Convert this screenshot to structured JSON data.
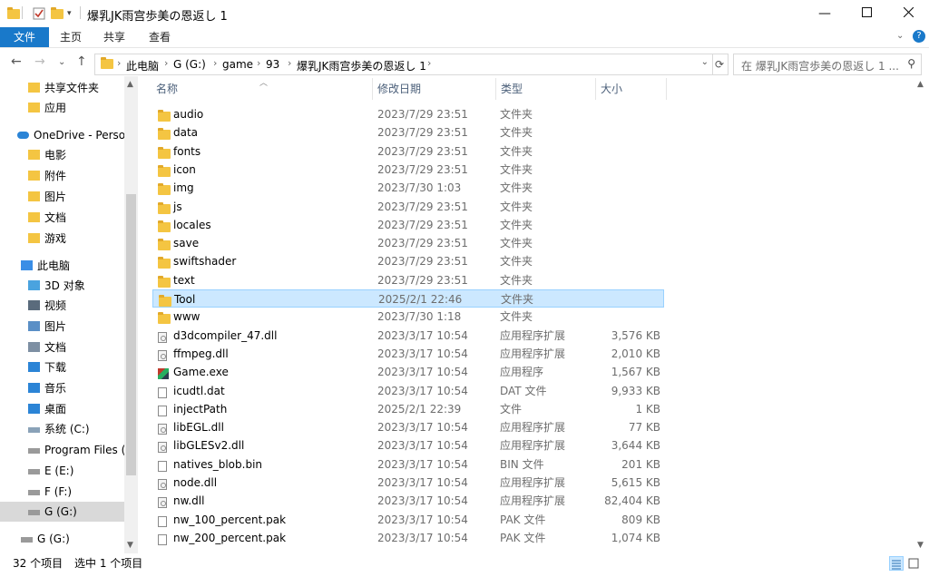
{
  "window": {
    "title": "爆乳JK雨宫歩美の恩返し 1",
    "min_icon": "minimize-icon",
    "max_icon": "maximize-icon",
    "close_icon": "close-icon"
  },
  "ribbon": {
    "tabs": [
      "文件",
      "主页",
      "共享",
      "查看"
    ]
  },
  "address": {
    "crumbs": [
      "此电脑",
      "G (G:)",
      "game",
      "93",
      "爆乳JK雨宫歩美の恩返し 1"
    ],
    "search_placeholder": "在 爆乳JK雨宫歩美の恩返し 1 ..."
  },
  "nav": {
    "items": [
      {
        "label": "共享文件夹",
        "icon": "shared-folder-icon"
      },
      {
        "label": "应用",
        "icon": "folder-icon"
      },
      {
        "label": "OneDrive - Personal",
        "icon": "cloud-icon"
      },
      {
        "label": "电影",
        "icon": "folder-icon"
      },
      {
        "label": "附件",
        "icon": "folder-icon"
      },
      {
        "label": "图片",
        "icon": "folder-icon"
      },
      {
        "label": "文档",
        "icon": "folder-icon"
      },
      {
        "label": "游戏",
        "icon": "folder-icon"
      },
      {
        "label": "此电脑",
        "icon": "pc-icon"
      },
      {
        "label": "3D 对象",
        "icon": "3d-objects-icon"
      },
      {
        "label": "视频",
        "icon": "video-icon"
      },
      {
        "label": "图片",
        "icon": "pictures-icon"
      },
      {
        "label": "文档",
        "icon": "documents-icon"
      },
      {
        "label": "下载",
        "icon": "download-icon"
      },
      {
        "label": "音乐",
        "icon": "music-icon"
      },
      {
        "label": "桌面",
        "icon": "desktop-icon"
      },
      {
        "label": "系统 (C:)",
        "icon": "system-drive-icon"
      },
      {
        "label": "Program Files (D:)",
        "icon": "drive-icon"
      },
      {
        "label": "E (E:)",
        "icon": "drive-icon"
      },
      {
        "label": "F (F:)",
        "icon": "drive-icon"
      },
      {
        "label": "G (G:)",
        "icon": "drive-icon"
      },
      {
        "label": "G (G:)",
        "icon": "drive-icon"
      }
    ]
  },
  "columns": {
    "name": "名称",
    "date": "修改日期",
    "type": "类型",
    "size": "大小"
  },
  "files": [
    {
      "name": "audio",
      "date": "2023/7/29 23:51",
      "type": "文件夹",
      "size": "",
      "icon": "folder-icon"
    },
    {
      "name": "data",
      "date": "2023/7/29 23:51",
      "type": "文件夹",
      "size": "",
      "icon": "folder-icon"
    },
    {
      "name": "fonts",
      "date": "2023/7/29 23:51",
      "type": "文件夹",
      "size": "",
      "icon": "folder-icon"
    },
    {
      "name": "icon",
      "date": "2023/7/29 23:51",
      "type": "文件夹",
      "size": "",
      "icon": "folder-icon"
    },
    {
      "name": "img",
      "date": "2023/7/30 1:03",
      "type": "文件夹",
      "size": "",
      "icon": "folder-icon"
    },
    {
      "name": "js",
      "date": "2023/7/29 23:51",
      "type": "文件夹",
      "size": "",
      "icon": "folder-icon"
    },
    {
      "name": "locales",
      "date": "2023/7/29 23:51",
      "type": "文件夹",
      "size": "",
      "icon": "folder-icon"
    },
    {
      "name": "save",
      "date": "2023/7/29 23:51",
      "type": "文件夹",
      "size": "",
      "icon": "folder-icon"
    },
    {
      "name": "swiftshader",
      "date": "2023/7/29 23:51",
      "type": "文件夹",
      "size": "",
      "icon": "folder-icon"
    },
    {
      "name": "text",
      "date": "2023/7/29 23:51",
      "type": "文件夹",
      "size": "",
      "icon": "folder-icon"
    },
    {
      "name": "Tool",
      "date": "2025/2/1 22:46",
      "type": "文件夹",
      "size": "",
      "icon": "folder-icon",
      "selected": true
    },
    {
      "name": "www",
      "date": "2023/7/30 1:18",
      "type": "文件夹",
      "size": "",
      "icon": "folder-icon"
    },
    {
      "name": "d3dcompiler_47.dll",
      "date": "2023/3/17 10:54",
      "type": "应用程序扩展",
      "size": "3,576 KB",
      "icon": "dll-icon"
    },
    {
      "name": "ffmpeg.dll",
      "date": "2023/3/17 10:54",
      "type": "应用程序扩展",
      "size": "2,010 KB",
      "icon": "dll-icon"
    },
    {
      "name": "Game.exe",
      "date": "2023/3/17 10:54",
      "type": "应用程序",
      "size": "1,567 KB",
      "icon": "exe-icon"
    },
    {
      "name": "icudtl.dat",
      "date": "2023/3/17 10:54",
      "type": "DAT 文件",
      "size": "9,933 KB",
      "icon": "file-icon"
    },
    {
      "name": "injectPath",
      "date": "2025/2/1 22:39",
      "type": "文件",
      "size": "1 KB",
      "icon": "file-icon"
    },
    {
      "name": "libEGL.dll",
      "date": "2023/3/17 10:54",
      "type": "应用程序扩展",
      "size": "77 KB",
      "icon": "dll-icon"
    },
    {
      "name": "libGLESv2.dll",
      "date": "2023/3/17 10:54",
      "type": "应用程序扩展",
      "size": "3,644 KB",
      "icon": "dll-icon"
    },
    {
      "name": "natives_blob.bin",
      "date": "2023/3/17 10:54",
      "type": "BIN 文件",
      "size": "201 KB",
      "icon": "file-icon"
    },
    {
      "name": "node.dll",
      "date": "2023/3/17 10:54",
      "type": "应用程序扩展",
      "size": "5,615 KB",
      "icon": "dll-icon"
    },
    {
      "name": "nw.dll",
      "date": "2023/3/17 10:54",
      "type": "应用程序扩展",
      "size": "82,404 KB",
      "icon": "dll-icon"
    },
    {
      "name": "nw_100_percent.pak",
      "date": "2023/3/17 10:54",
      "type": "PAK 文件",
      "size": "809 KB",
      "icon": "file-icon"
    },
    {
      "name": "nw_200_percent.pak",
      "date": "2023/3/17 10:54",
      "type": "PAK 文件",
      "size": "1,074 KB",
      "icon": "file-icon"
    }
  ],
  "status": {
    "count": "32 个项目",
    "selected": "选中 1 个项目"
  }
}
